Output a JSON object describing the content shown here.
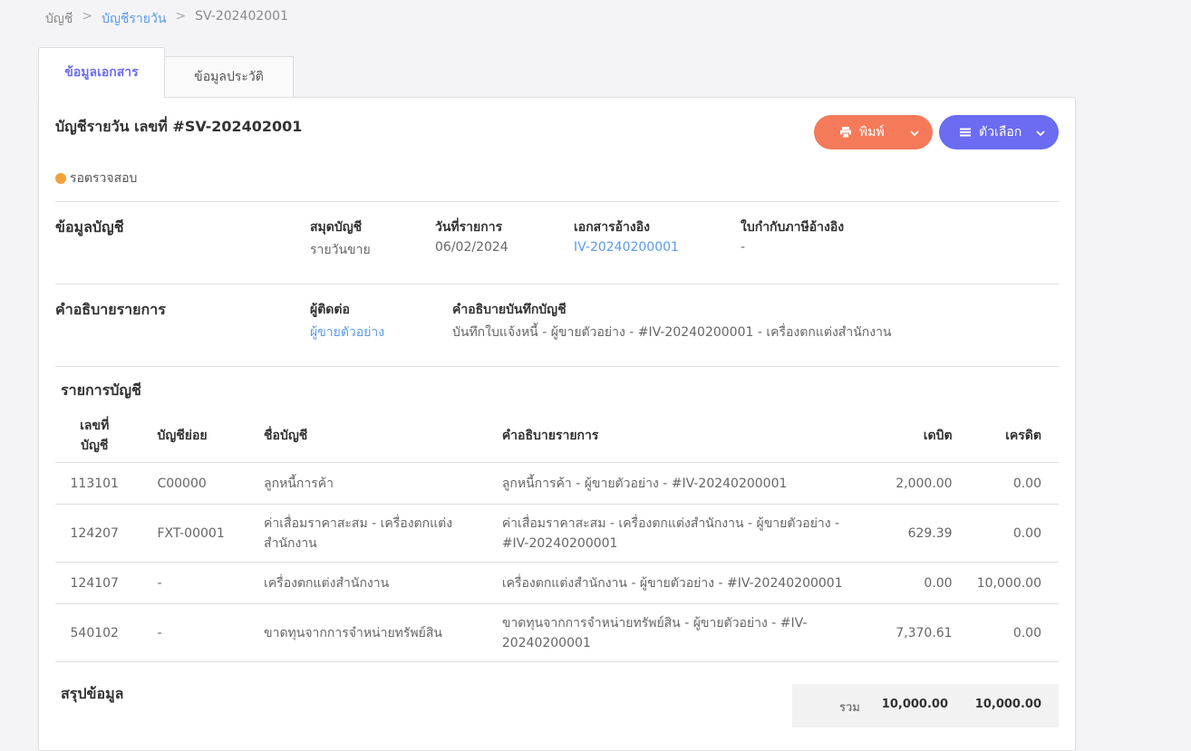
{
  "breadcrumb": {
    "root": "บัญชี",
    "sep": ">",
    "parent": "บัญชีรายวัน",
    "current": "SV-202402001"
  },
  "tabs": [
    {
      "label": "ข้อมูลเอกสาร",
      "active": true
    },
    {
      "label": "ข้อมูลประวัติ",
      "active": false
    }
  ],
  "document": {
    "title": "บัญชีรายวัน เลขที่ #SV-202402001",
    "status": "รอตรวจสอบ",
    "status_color": "#f5a13a"
  },
  "actions": {
    "print_label": "พิมพ์",
    "options_label": "ตัวเลือก",
    "print_color": "#f57a5a",
    "options_color": "#6b6cf2"
  },
  "account_info": {
    "section_label": "ข้อมูลบัญชี",
    "book_label": "สมุดบัญชี",
    "book_value": "รายวันขาย",
    "date_label": "วันที่รายการ",
    "date_value": "06/02/2024",
    "ref_doc_label": "เอกสารอ้างอิง",
    "ref_doc_value": "IV-20240200001",
    "tax_ref_label": "ใบกำกับภาษีอ้างอิง",
    "tax_ref_value": "-"
  },
  "description": {
    "section_label": "คำอธิบายรายการ",
    "contact_label": "ผู้ติดต่อ",
    "contact_value": "ผู้ขายตัวอย่าง",
    "memo_label": "คำอธิบายบันทึกบัญชี",
    "memo_value": "บันทึกใบแจ้งหนี้ - ผู้ขายตัวอย่าง - #IV-20240200001 - เครื่องตกแต่งสำนักงาน"
  },
  "ledger": {
    "section_label": "รายการบัญชี",
    "headers": {
      "account_no": "เลขที่บัญชี",
      "sub_account": "บัญชีย่อย",
      "account_name": "ชื่อบัญชี",
      "description": "คำอธิบายรายการ",
      "debit": "เดบิต",
      "credit": "เครดิต"
    },
    "rows": [
      {
        "account_no": "113101",
        "sub_account": "C00000",
        "account_name": "ลูกหนี้การค้า",
        "description": "ลูกหนี้การค้า - ผู้ขายตัวอย่าง - #IV-20240200001",
        "debit": "2,000.00",
        "credit": "0.00"
      },
      {
        "account_no": "124207",
        "sub_account": "FXT-00001",
        "account_name": "ค่าเสื่อมราคาสะสม - เครื่องตกแต่งสำนักงาน",
        "description": "ค่าเสื่อมราคาสะสม - เครื่องตกแต่งสำนักงาน - ผู้ขายตัวอย่าง - #IV-20240200001",
        "debit": "629.39",
        "credit": "0.00"
      },
      {
        "account_no": "124107",
        "sub_account": "-",
        "account_name": "เครื่องตกแต่งสำนักงาน",
        "description": "เครื่องตกแต่งสำนักงาน - ผู้ขายตัวอย่าง - #IV-20240200001",
        "debit": "0.00",
        "credit": "10,000.00"
      },
      {
        "account_no": "540102",
        "sub_account": "-",
        "account_name": "ขาดทุนจากการจำหน่ายทรัพย์สิน",
        "description": "ขาดทุนจากการจำหน่ายทรัพย์สิน - ผู้ขายตัวอย่าง - #IV-20240200001",
        "debit": "7,370.61",
        "credit": "0.00"
      }
    ]
  },
  "summary": {
    "section_label": "สรุปข้อมูล",
    "total_label": "รวม",
    "total_debit": "10,000.00",
    "total_credit": "10,000.00"
  }
}
